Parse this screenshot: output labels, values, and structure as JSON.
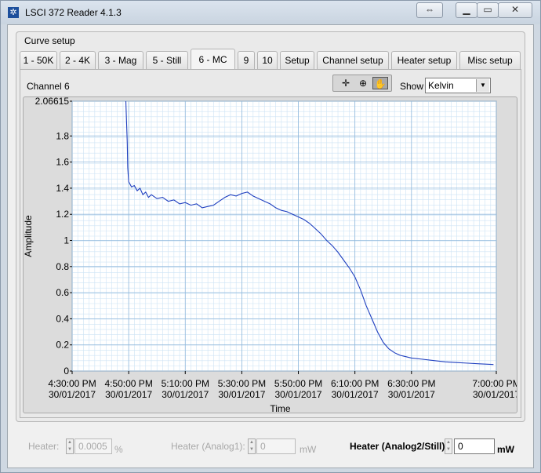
{
  "window": {
    "title": "LSCI 372 Reader 4.1.3",
    "extra_button_icon": "double-arrow-icon",
    "controls": [
      "minimize-icon",
      "maximize-icon",
      "close-icon"
    ]
  },
  "curve_setup": {
    "label": "Curve setup",
    "tabs": [
      {
        "label": "1 - 50K"
      },
      {
        "label": "2 - 4K"
      },
      {
        "label": "3 - Mag"
      },
      {
        "label": "5 - Still"
      },
      {
        "label": "6 - MC",
        "active": true
      },
      {
        "label": "9"
      },
      {
        "label": "10"
      },
      {
        "label": "Setup"
      },
      {
        "label": "Channel setup"
      },
      {
        "label": "Heater setup"
      },
      {
        "label": "Misc setup"
      }
    ]
  },
  "graph_panel": {
    "channel_label": "Channel 6",
    "palette_tools": [
      "crosshair-icon",
      "zoom-icon",
      "pan-hand-icon"
    ],
    "show_label": "Show",
    "show_value": "Kelvin"
  },
  "chart_data": {
    "type": "line",
    "xlabel": "Time",
    "ylabel": "Amplitude",
    "ylim": [
      0,
      2.06615
    ],
    "yticks": [
      "0",
      "0.2",
      "0.4",
      "0.6",
      "0.8",
      "1",
      "1.2",
      "1.4",
      "1.6",
      "1.8",
      "2.06615"
    ],
    "xlim": [
      "16:30",
      "19:00"
    ],
    "xticks": [
      {
        "time": "4:30:00 PM",
        "date": "30/01/2017"
      },
      {
        "time": "4:50:00 PM",
        "date": "30/01/2017"
      },
      {
        "time": "5:10:00 PM",
        "date": "30/01/2017"
      },
      {
        "time": "5:30:00 PM",
        "date": "30/01/2017"
      },
      {
        "time": "5:50:00 PM",
        "date": "30/01/2017"
      },
      {
        "time": "6:10:00 PM",
        "date": "30/01/2017"
      },
      {
        "time": "6:30:00 PM",
        "date": "30/01/2017"
      },
      {
        "time": "7:00:00 PM",
        "date": "30/01/2017"
      }
    ],
    "grid": true,
    "line_color": "#1f3fbf",
    "series": [
      {
        "points": [
          [
            "16:49",
            2.06615
          ],
          [
            "16:49:30",
            1.75
          ],
          [
            "16:49:40",
            1.56
          ],
          [
            "16:50:00",
            1.45
          ],
          [
            "16:51",
            1.41
          ],
          [
            "16:52",
            1.42
          ],
          [
            "16:53",
            1.38
          ],
          [
            "16:54",
            1.4
          ],
          [
            "16:55",
            1.35
          ],
          [
            "16:56",
            1.37
          ],
          [
            "16:57",
            1.33
          ],
          [
            "16:58",
            1.35
          ],
          [
            "17:00",
            1.32
          ],
          [
            "17:02",
            1.33
          ],
          [
            "17:04",
            1.3
          ],
          [
            "17:06",
            1.31
          ],
          [
            "17:08",
            1.28
          ],
          [
            "17:10",
            1.29
          ],
          [
            "17:12",
            1.27
          ],
          [
            "17:14",
            1.28
          ],
          [
            "17:16",
            1.25
          ],
          [
            "17:18",
            1.26
          ],
          [
            "17:20",
            1.27
          ],
          [
            "17:22",
            1.3
          ],
          [
            "17:24",
            1.33
          ],
          [
            "17:26",
            1.35
          ],
          [
            "17:28",
            1.34
          ],
          [
            "17:30",
            1.36
          ],
          [
            "17:32",
            1.37
          ],
          [
            "17:34",
            1.34
          ],
          [
            "17:36",
            1.32
          ],
          [
            "17:38",
            1.3
          ],
          [
            "17:40",
            1.28
          ],
          [
            "17:42",
            1.25
          ],
          [
            "17:44",
            1.23
          ],
          [
            "17:46",
            1.22
          ],
          [
            "17:48",
            1.2
          ],
          [
            "17:50",
            1.18
          ],
          [
            "17:52",
            1.16
          ],
          [
            "17:54",
            1.13
          ],
          [
            "17:56",
            1.09
          ],
          [
            "17:58",
            1.05
          ],
          [
            "18:00",
            1.0
          ],
          [
            "18:02",
            0.96
          ],
          [
            "18:04",
            0.91
          ],
          [
            "18:06",
            0.85
          ],
          [
            "18:08",
            0.79
          ],
          [
            "18:10",
            0.72
          ],
          [
            "18:12",
            0.62
          ],
          [
            "18:14",
            0.5
          ],
          [
            "18:16",
            0.4
          ],
          [
            "18:18",
            0.3
          ],
          [
            "18:20",
            0.22
          ],
          [
            "18:22",
            0.17
          ],
          [
            "18:24",
            0.14
          ],
          [
            "18:26",
            0.12
          ],
          [
            "18:28",
            0.11
          ],
          [
            "18:30",
            0.1
          ],
          [
            "18:34",
            0.09
          ],
          [
            "18:38",
            0.08
          ],
          [
            "18:42",
            0.07
          ],
          [
            "18:46",
            0.065
          ],
          [
            "18:50",
            0.06
          ],
          [
            "18:54",
            0.055
          ],
          [
            "18:59",
            0.05
          ]
        ]
      }
    ]
  },
  "bottom_controls": {
    "heater_label": "Heater:",
    "heater_value": "0.0005",
    "heater_unit": "%",
    "heater_analog1_label": "Heater (Analog1):",
    "heater_analog1_value": "0",
    "heater_analog1_unit": "mW",
    "heater_analog2_label": "Heater (Analog2/Still):",
    "heater_analog2_value": "0",
    "heater_analog2_unit": "mW"
  }
}
